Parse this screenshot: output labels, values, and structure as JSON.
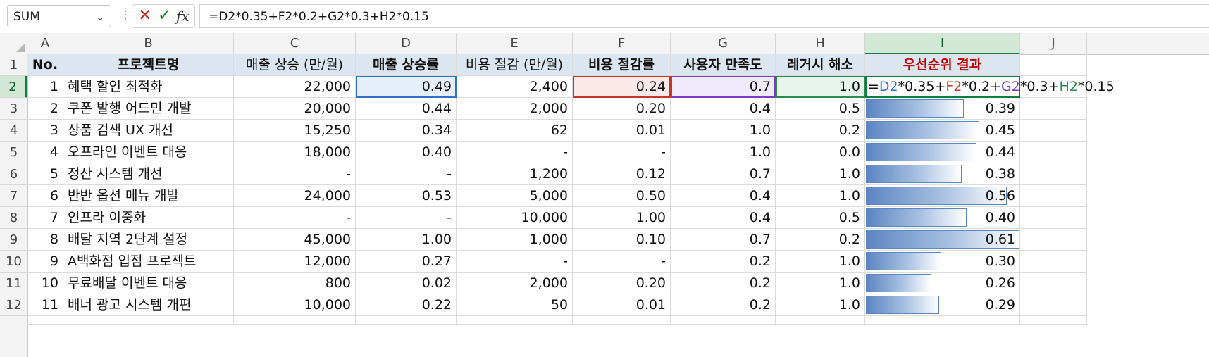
{
  "formula_bar": {
    "name_box": "SUM",
    "formula": "=D2*0.35+F2*0.2+G2*0.3+H2*0.15",
    "icons": [
      "cancel-icon",
      "enter-icon",
      "fx-icon"
    ]
  },
  "columns": [
    "A",
    "B",
    "C",
    "D",
    "E",
    "F",
    "G",
    "H",
    "I",
    "J"
  ],
  "rows_numbers": [
    "1",
    "2",
    "3",
    "4",
    "5",
    "6",
    "7",
    "8",
    "9",
    "10",
    "11",
    "12"
  ],
  "active_cell": "I2",
  "header": {
    "a": "No.",
    "b": "프로젝트명",
    "c": "매출 상승 (만/월)",
    "d": "매출 상승률",
    "e": "비용 절감 (만/월)",
    "f": "비용 절감률",
    "g": "사용자 만족도",
    "h": "레거시 해소",
    "i": "우선순위 결과"
  },
  "edit_formula_parts": {
    "eq": "=",
    "d": "D2",
    "p1": "*0.35+",
    "f": "F2",
    "p2": "*0.2+",
    "g": "G2",
    "p3": "*0.3+",
    "h": "H2",
    "p4": "*0.15"
  },
  "rows": [
    {
      "no": "1",
      "name": "혜택 할인 최적화",
      "c": "22,000",
      "d": "0.49",
      "e": "2,400",
      "f": "0.24",
      "g": "0.7",
      "h": "1.0",
      "i": ""
    },
    {
      "no": "2",
      "name": "쿠폰 발행 어드민 개발",
      "c": "20,000",
      "d": "0.44",
      "e": "2,000",
      "f": "0.20",
      "g": "0.4",
      "h": "0.5",
      "i": "0.39"
    },
    {
      "no": "3",
      "name": "상품 검색 UX 개선",
      "c": "15,250",
      "d": "0.34",
      "e": "62",
      "f": "0.01",
      "g": "1.0",
      "h": "0.2",
      "i": "0.45"
    },
    {
      "no": "4",
      "name": "오프라인 이벤트 대응",
      "c": "18,000",
      "d": "0.40",
      "e": "-",
      "f": "-",
      "g": "1.0",
      "h": "0.0",
      "i": "0.44"
    },
    {
      "no": "5",
      "name": "정산 시스템 개선",
      "c": "-",
      "d": "-",
      "e": "1,200",
      "f": "0.12",
      "g": "0.7",
      "h": "1.0",
      "i": "0.38"
    },
    {
      "no": "6",
      "name": "반반 옵션 메뉴 개발",
      "c": "24,000",
      "d": "0.53",
      "e": "5,000",
      "f": "0.50",
      "g": "0.4",
      "h": "1.0",
      "i": "0.56"
    },
    {
      "no": "7",
      "name": "인프라 이중화",
      "c": "-",
      "d": "-",
      "e": "10,000",
      "f": "1.00",
      "g": "0.4",
      "h": "0.5",
      "i": "0.40"
    },
    {
      "no": "8",
      "name": "배달 지역 2단계 설정",
      "c": "45,000",
      "d": "1.00",
      "e": "1,000",
      "f": "0.10",
      "g": "0.7",
      "h": "0.2",
      "i": "0.61"
    },
    {
      "no": "9",
      "name": "A백화점 입점 프로젝트",
      "c": "12,000",
      "d": "0.27",
      "e": "-",
      "f": "-",
      "g": "0.2",
      "h": "1.0",
      "i": "0.30"
    },
    {
      "no": "10",
      "name": "무료배달 이벤트 대응",
      "c": "800",
      "d": "0.02",
      "e": "2,000",
      "f": "0.20",
      "g": "0.2",
      "h": "1.0",
      "i": "0.26"
    },
    {
      "no": "11",
      "name": "배너 광고 시스템 개편",
      "c": "10,000",
      "d": "0.22",
      "e": "50",
      "f": "0.01",
      "g": "0.2",
      "h": "1.0",
      "i": "0.29"
    }
  ],
  "databar": {
    "min": 0,
    "max": 0.61,
    "colors": [
      "#5b86c2",
      "#a9c1e2"
    ]
  }
}
